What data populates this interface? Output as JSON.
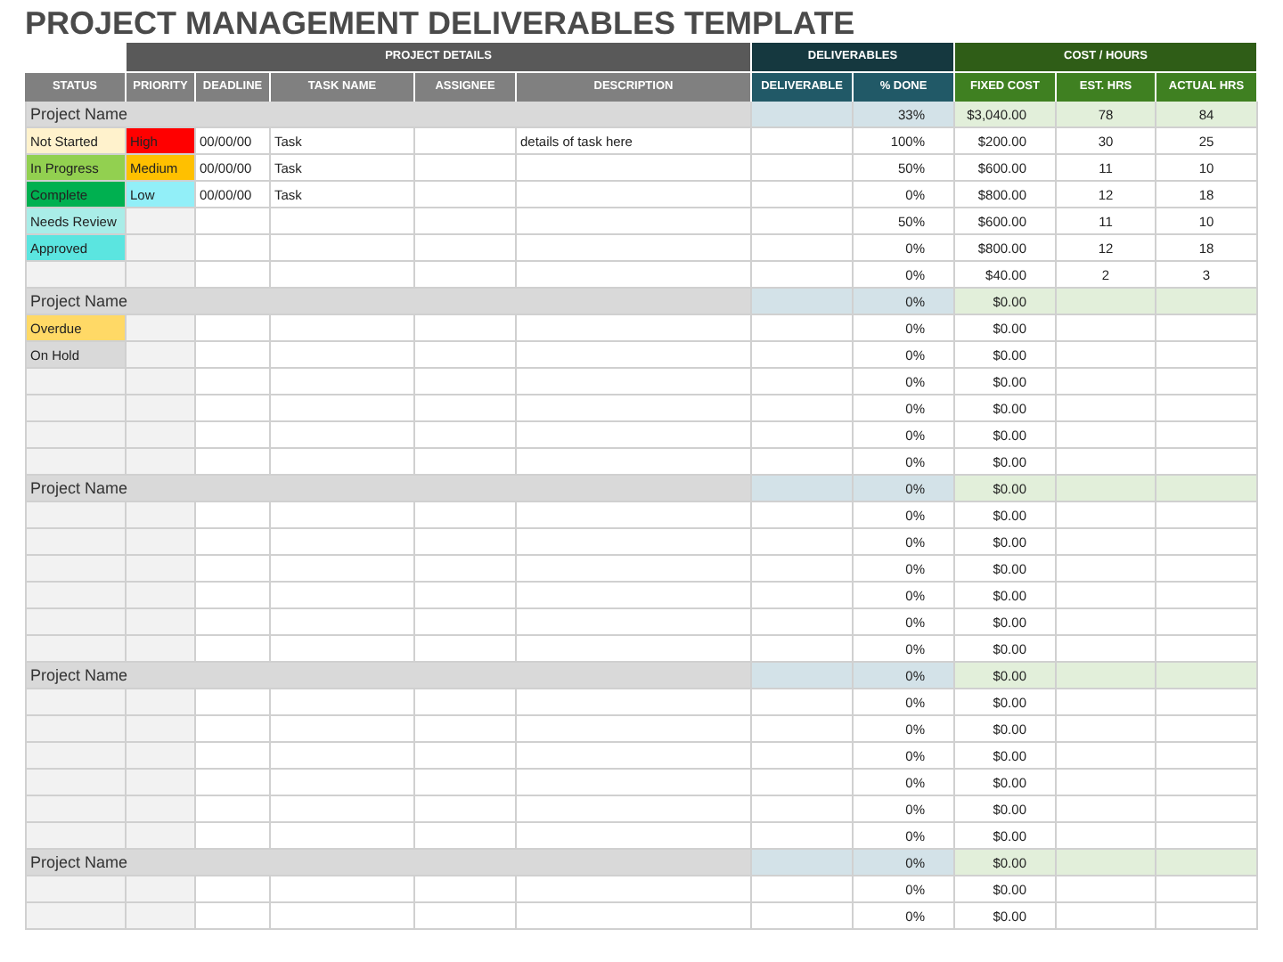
{
  "title": "PROJECT MANAGEMENT DELIVERABLES TEMPLATE",
  "group_headers": [
    {
      "label": "PROJECT DETAILS",
      "kind": "details"
    },
    {
      "label": "DELIVERABLES",
      "kind": "deliverables"
    },
    {
      "label": "COST / HOURS",
      "kind": "cost"
    }
  ],
  "columns": [
    {
      "label": "STATUS",
      "kind": "details"
    },
    {
      "label": "PRIORITY",
      "kind": "details"
    },
    {
      "label": "DEADLINE",
      "kind": "details"
    },
    {
      "label": "TASK NAME",
      "kind": "details"
    },
    {
      "label": "ASSIGNEE",
      "kind": "details"
    },
    {
      "label": "DESCRIPTION",
      "kind": "details"
    },
    {
      "label": "DELIVERABLE",
      "kind": "deliverables"
    },
    {
      "label": "% DONE",
      "kind": "deliverables"
    },
    {
      "label": "FIXED COST",
      "kind": "cost"
    },
    {
      "label": "EST. HRS",
      "kind": "cost"
    },
    {
      "label": "ACTUAL HRS",
      "kind": "cost"
    }
  ],
  "projects": [
    {
      "name": "Project Name",
      "done": "33%",
      "fixed_cost": "$3,040.00",
      "est_hrs": "78",
      "actual_hrs": "84",
      "tasks": [
        {
          "status": {
            "label": "Not Started",
            "color": "#fff2cc"
          },
          "priority": {
            "label": "High",
            "color": "#ff0000"
          },
          "deadline": "00/00/00",
          "task": "Task",
          "description": "details of task here",
          "done": "100%",
          "fixed_cost": "$200.00",
          "est_hrs": "30",
          "actual_hrs": "25"
        },
        {
          "status": {
            "label": "In Progress",
            "color": "#92d050"
          },
          "priority": {
            "label": "Medium",
            "color": "#ffc000"
          },
          "deadline": "00/00/00",
          "task": "Task",
          "done": "50%",
          "fixed_cost": "$600.00",
          "est_hrs": "11",
          "actual_hrs": "10"
        },
        {
          "status": {
            "label": "Complete",
            "color": "#00b050"
          },
          "priority": {
            "label": "Low",
            "color": "#92eff8"
          },
          "deadline": "00/00/00",
          "task": "Task",
          "done": "0%",
          "fixed_cost": "$800.00",
          "est_hrs": "12",
          "actual_hrs": "18"
        },
        {
          "status": {
            "label": "Needs Review",
            "color": "#a9ede8"
          },
          "done": "50%",
          "fixed_cost": "$600.00",
          "est_hrs": "11",
          "actual_hrs": "10"
        },
        {
          "status": {
            "label": "Approved",
            "color": "#5be5e0"
          },
          "done": "0%",
          "fixed_cost": "$800.00",
          "est_hrs": "12",
          "actual_hrs": "18"
        },
        {
          "done": "0%",
          "fixed_cost": "$40.00",
          "est_hrs": "2",
          "actual_hrs": "3"
        }
      ]
    },
    {
      "name": "Project Name",
      "done": "0%",
      "fixed_cost": "$0.00",
      "tasks": [
        {
          "status": {
            "label": "Overdue",
            "color": "#ffd966"
          },
          "done": "0%",
          "fixed_cost": "$0.00"
        },
        {
          "status": {
            "label": "On Hold",
            "color": "#d9d9d9"
          },
          "done": "0%",
          "fixed_cost": "$0.00"
        },
        {
          "done": "0%",
          "fixed_cost": "$0.00"
        },
        {
          "done": "0%",
          "fixed_cost": "$0.00"
        },
        {
          "done": "0%",
          "fixed_cost": "$0.00"
        },
        {
          "done": "0%",
          "fixed_cost": "$0.00"
        }
      ]
    },
    {
      "name": "Project Name",
      "done": "0%",
      "fixed_cost": "$0.00",
      "tasks": [
        {
          "done": "0%",
          "fixed_cost": "$0.00"
        },
        {
          "done": "0%",
          "fixed_cost": "$0.00"
        },
        {
          "done": "0%",
          "fixed_cost": "$0.00"
        },
        {
          "done": "0%",
          "fixed_cost": "$0.00"
        },
        {
          "done": "0%",
          "fixed_cost": "$0.00"
        },
        {
          "done": "0%",
          "fixed_cost": "$0.00"
        }
      ]
    },
    {
      "name": "Project Name",
      "done": "0%",
      "fixed_cost": "$0.00",
      "tasks": [
        {
          "done": "0%",
          "fixed_cost": "$0.00"
        },
        {
          "done": "0%",
          "fixed_cost": "$0.00"
        },
        {
          "done": "0%",
          "fixed_cost": "$0.00"
        },
        {
          "done": "0%",
          "fixed_cost": "$0.00"
        },
        {
          "done": "0%",
          "fixed_cost": "$0.00"
        },
        {
          "done": "0%",
          "fixed_cost": "$0.00"
        }
      ]
    },
    {
      "name": "Project Name",
      "done": "0%",
      "fixed_cost": "$0.00",
      "tasks": [
        {
          "done": "0%",
          "fixed_cost": "$0.00"
        },
        {
          "done": "0%",
          "fixed_cost": "$0.00"
        }
      ]
    }
  ]
}
